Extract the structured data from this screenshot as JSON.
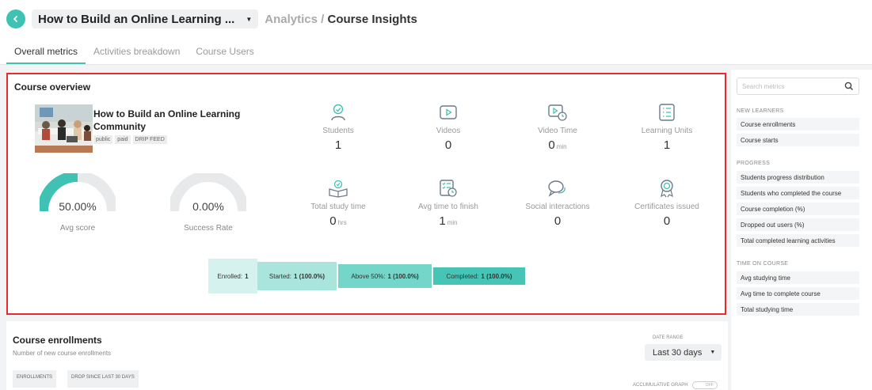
{
  "header": {
    "course_title": "How to Build an Online Learning ...",
    "breadcrumb_parent": "Analytics",
    "breadcrumb_sep": " / ",
    "breadcrumb_current": "Course Insights"
  },
  "tabs": [
    {
      "label": "Overall metrics",
      "active": true
    },
    {
      "label": "Activities breakdown",
      "active": false
    },
    {
      "label": "Course Users",
      "active": false
    }
  ],
  "overview": {
    "title": "Course overview",
    "course_name": "How to Build an Online Learning Community",
    "tags": [
      "public",
      "paid",
      "DRIP FEED"
    ],
    "gauges": [
      {
        "value": "50.00%",
        "label": "Avg score",
        "fraction": 0.5
      },
      {
        "value": "0.00%",
        "label": "Success Rate",
        "fraction": 0.0
      }
    ],
    "metrics": [
      {
        "icon": "students-icon",
        "label": "Students",
        "value": "1",
        "unit": ""
      },
      {
        "icon": "videos-icon",
        "label": "Videos",
        "value": "0",
        "unit": ""
      },
      {
        "icon": "video-time-icon",
        "label": "Video Time",
        "value": "0",
        "unit": "min"
      },
      {
        "icon": "learning-units-icon",
        "label": "Learning Units",
        "value": "1",
        "unit": ""
      },
      {
        "icon": "study-time-icon",
        "label": "Total study time",
        "value": "0",
        "unit": "hrs"
      },
      {
        "icon": "avg-finish-icon",
        "label": "Avg time to finish",
        "value": "1",
        "unit": "min"
      },
      {
        "icon": "social-icon",
        "label": "Social interactions",
        "value": "0",
        "unit": ""
      },
      {
        "icon": "certificate-icon",
        "label": "Certificates issued",
        "value": "0",
        "unit": ""
      }
    ],
    "funnel": [
      {
        "label": "Enrolled:",
        "value": "1"
      },
      {
        "label": "Started:",
        "value": "1 (100.0%)"
      },
      {
        "label": "Above 50%:",
        "value": "1 (100.0%)"
      },
      {
        "label": "Completed:",
        "value": "1 (100.0%)"
      }
    ]
  },
  "sidebar": {
    "search_placeholder": "Search metrics",
    "sections": [
      {
        "title": "NEW LEARNERS",
        "items": [
          "Course enrollments",
          "Course starts"
        ]
      },
      {
        "title": "PROGRESS",
        "items": [
          "Students progress distribution",
          "Students who completed the course",
          "Course completion (%)",
          "Dropped out users (%)",
          "Total completed learning activities"
        ]
      },
      {
        "title": "TIME ON COURSE",
        "items": [
          "Avg studying time",
          "Avg time to complete course",
          "Total studying time"
        ]
      }
    ]
  },
  "enrollments": {
    "title": "Course enrollments",
    "subtitle": "Number of new course enrollments",
    "date_range_label": "DATE RANGE",
    "date_range_value": "Last 30 days",
    "chip_enrollments": "ENROLLMENTS",
    "chip_drop": "DROP SINCE LAST 30 DAYS",
    "accumulative_label": "ACCUMULATIVE GRAPH",
    "toggle_label": "OFF"
  },
  "colors": {
    "accent": "#3fc2b3",
    "highlight_border": "#e52b2b",
    "funnel": [
      "#d6f2ee",
      "#a9e5dd",
      "#74d5c9",
      "#46c4b5"
    ]
  }
}
